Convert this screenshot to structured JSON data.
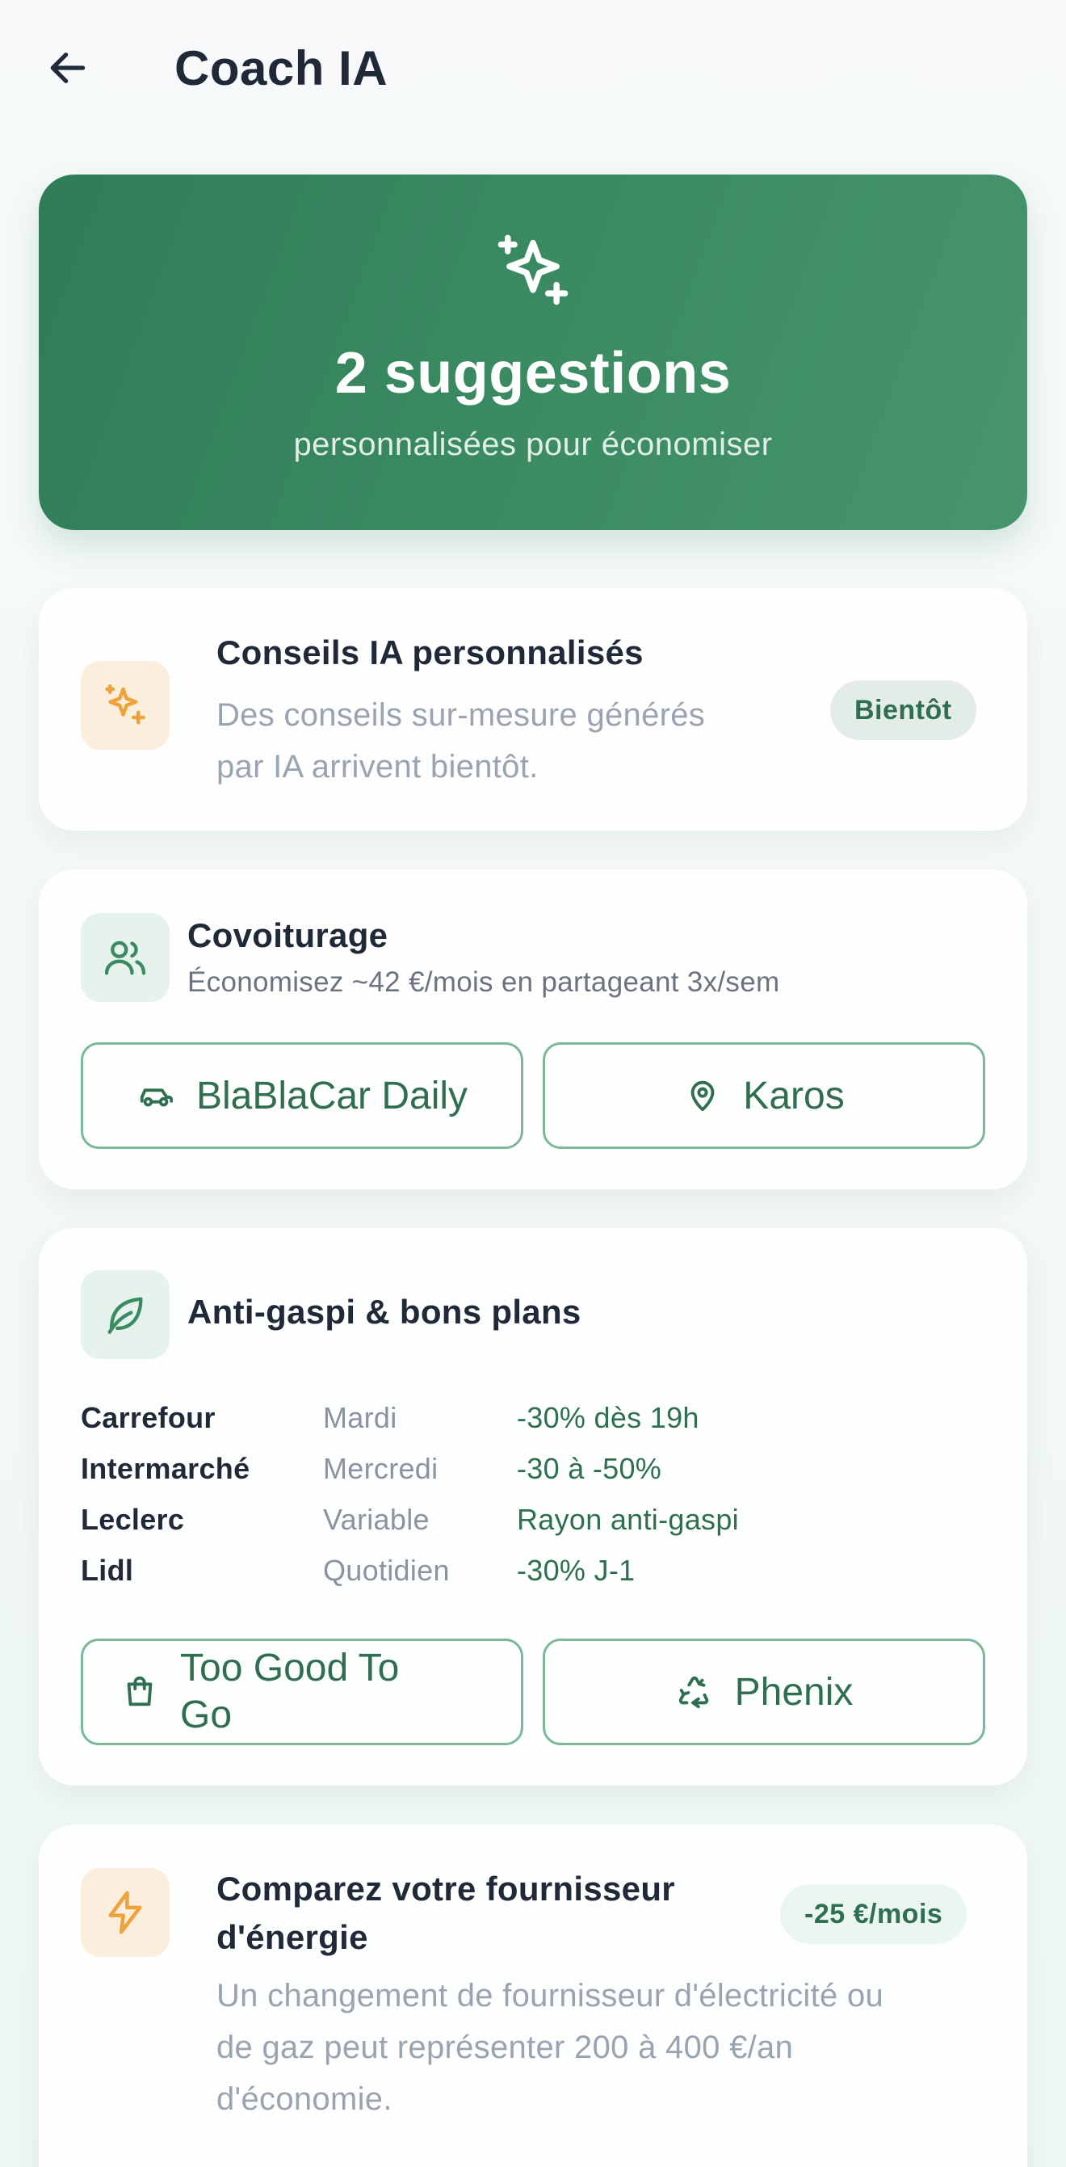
{
  "header": {
    "title": "Coach IA"
  },
  "hero": {
    "count": "2 suggestions",
    "subtitle": "personnalisées pour économiser"
  },
  "ai_card": {
    "title": "Conseils IA personnalisés",
    "desc_line1": "Des conseils sur-mesure générés",
    "desc_line2": "par IA arrivent bientôt.",
    "badge": "Bientôt"
  },
  "carpool": {
    "title": "Covoiturage",
    "desc": "Économisez ~42 €/mois en partageant 3x/sem",
    "btn1": "BlaBlaCar Daily",
    "btn2": "Karos"
  },
  "antigaspi": {
    "title": "Anti-gaspi & bons plans",
    "rows": [
      {
        "store": "Carrefour",
        "day": "Mardi",
        "offer": "-30% dès 19h"
      },
      {
        "store": "Intermarché",
        "day": "Mercredi",
        "offer": "-30 à -50%"
      },
      {
        "store": "Leclerc",
        "day": "Variable",
        "offer": "Rayon anti-gaspi"
      },
      {
        "store": "Lidl",
        "day": "Quotidien",
        "offer": "-30% J-1"
      }
    ],
    "btn1_line1": "Too Good To",
    "btn1_line2": "Go",
    "btn2": "Phenix"
  },
  "energy": {
    "title_line1": "Comparez votre fournisseur",
    "title_line2": "d'énergie",
    "badge": "-25 €/mois",
    "desc_line1": "Un changement de fournisseur d'électricité ou",
    "desc_line2": "de gaz peut représenter 200 à 400 €/an",
    "desc_line3": "d'économie."
  },
  "colors": {
    "primary": "#2f7d57",
    "accent_orange": "#f0a23a",
    "text": "#1f2937",
    "muted": "#9aa3b0"
  }
}
